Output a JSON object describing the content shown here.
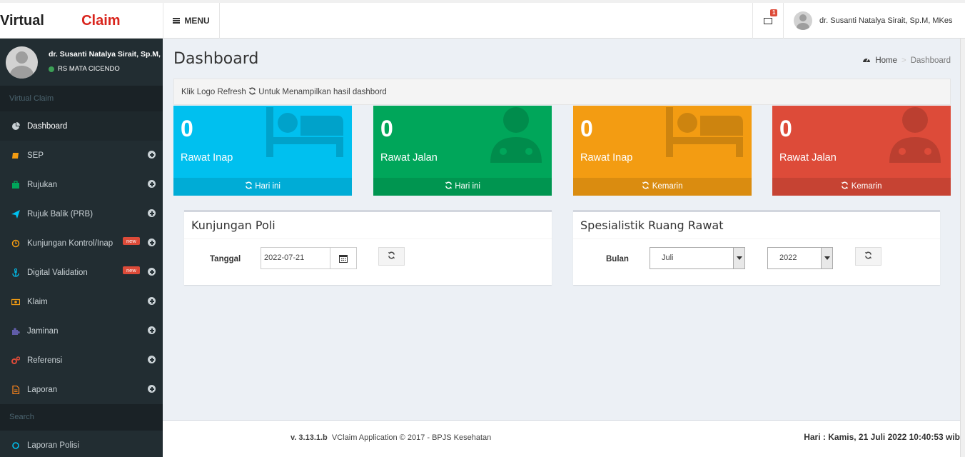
{
  "app": {
    "logo_part1": "Virtual",
    "logo_part2": "Claim"
  },
  "header": {
    "menu_label": "MENU",
    "mail_badge": "1",
    "user_name": "dr. Susanti Natalya Sirait, Sp.M, MKes"
  },
  "sidebar": {
    "user_name": "dr. Susanti Natalya Sirait, Sp.M,",
    "user_status": "RS MATA CICENDO",
    "section_header": "Virtual Claim",
    "items": [
      {
        "label": "Dashboard",
        "icon": "dashboard-icon",
        "color": "#c9d1d5"
      },
      {
        "label": "SEP",
        "icon": "book-icon",
        "color": "#f39c12"
      },
      {
        "label": "Rujukan",
        "icon": "briefcase-icon",
        "color": "#00a65a"
      },
      {
        "label": "Rujuk Balik (PRB)",
        "icon": "send-icon",
        "color": "#00c0ef"
      },
      {
        "label": "Kunjungan Kontrol/Inap",
        "icon": "clock-icon",
        "color": "#f39c12",
        "badge": "new"
      },
      {
        "label": "Digital Validation",
        "icon": "anchor-icon",
        "color": "#00c0ef",
        "badge": "new"
      },
      {
        "label": "Klaim",
        "icon": "money-icon",
        "color": "#f39c12"
      },
      {
        "label": "Jaminan",
        "icon": "puzzle-icon",
        "color": "#605ca8"
      },
      {
        "label": "Referensi",
        "icon": "cogs-icon",
        "color": "#dd4b39"
      },
      {
        "label": "Laporan",
        "icon": "file-icon",
        "color": "#ff851b"
      }
    ],
    "search_header": "Search",
    "extra_item": {
      "label": "Laporan Polisi",
      "icon": "circle-icon",
      "color": "#00c0ef"
    }
  },
  "page": {
    "title": "Dashboard",
    "breadcrumb_home": "Home",
    "breadcrumb_current": "Dashboard",
    "callout_prefix": "Klik Logo Refresh",
    "callout_suffix": "Untuk Menampilkan hasil dashbord"
  },
  "stat_boxes": [
    {
      "value": "0",
      "label": "Rawat Inap",
      "footer": "Hari ini",
      "color": "#00c0ef",
      "icon": "bed-icon"
    },
    {
      "value": "0",
      "label": "Rawat Jalan",
      "footer": "Hari ini",
      "color": "#00a65a",
      "icon": "user-md-icon"
    },
    {
      "value": "0",
      "label": "Rawat Inap",
      "footer": "Kemarin",
      "color": "#f39c12",
      "icon": "bed-icon"
    },
    {
      "value": "0",
      "label": "Rawat Jalan",
      "footer": "Kemarin",
      "color": "#dd4b39",
      "icon": "user-md-icon"
    }
  ],
  "kunjungan_poli": {
    "title": "Kunjungan Poli",
    "date_label": "Tanggal",
    "date_value": "2022-07-21"
  },
  "spesialistik": {
    "title": "Spesialistik Ruang Rawat",
    "month_label": "Bulan",
    "month_value": "Juli",
    "year_value": "2022"
  },
  "footer": {
    "version": "v. 3.13.1.b",
    "copyright": "VClaim Application © 2017 - BPJS Kesehatan",
    "datetime": "Hari : Kamis, 21 Juli 2022 10:40:53 wib"
  }
}
